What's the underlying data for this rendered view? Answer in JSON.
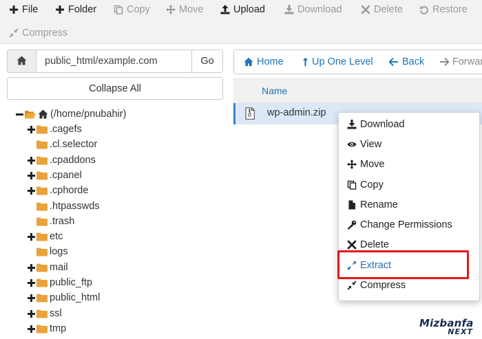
{
  "toolbar": {
    "file": "File",
    "folder": "Folder",
    "copy": "Copy",
    "move": "Move",
    "upload": "Upload",
    "download": "Download",
    "delete": "Delete",
    "restore": "Restore",
    "compress": "Compress"
  },
  "pathbar": {
    "path_value": "public_html/example.com",
    "go_label": "Go"
  },
  "collapse_label": "Collapse All",
  "tree": {
    "root": "(/home/pnubahir)",
    "items": [
      ".cagefs",
      ".cl.selector",
      ".cpaddons",
      ".cpanel",
      ".cphorde",
      ".htpasswds",
      ".trash",
      "etc",
      "logs",
      "mail",
      "public_ftp",
      "public_html",
      "ssl",
      "tmp"
    ]
  },
  "nav": {
    "home": "Home",
    "up": "Up One Level",
    "back": "Back",
    "forward": "Forward"
  },
  "table": {
    "name_header": "Name",
    "file_name": "wp-admin.zip"
  },
  "context_menu": {
    "download": "Download",
    "view": "View",
    "move": "Move",
    "copy": "Copy",
    "rename": "Rename",
    "change_permissions": "Change Permissions",
    "delete": "Delete",
    "extract": "Extract",
    "compress": "Compress"
  },
  "watermark": {
    "main": "Mizbanfa",
    "sub": "NEXT"
  },
  "colors": {
    "link": "#1d74b7",
    "folder": "#e8a33a",
    "highlight": "#e01919",
    "selected_row": "#dce8f7"
  }
}
